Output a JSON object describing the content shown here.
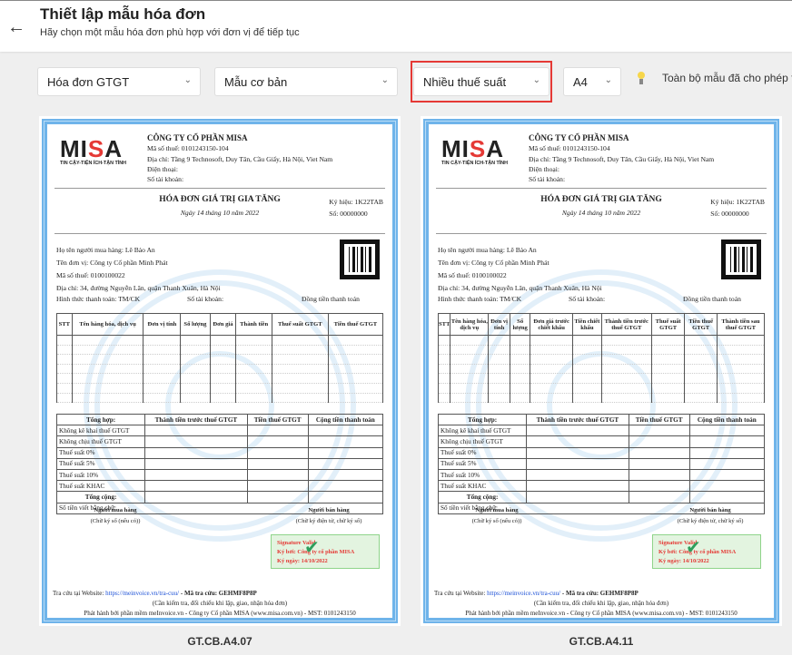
{
  "header": {
    "title": "Thiết lập mẫu hóa đơn",
    "subtitle": "Hãy chọn một mẫu hóa đơn phù hợp với đơn vị để tiếp tục"
  },
  "filters": {
    "invoice_type": "Hóa đơn GTGT",
    "template_style": "Mẫu cơ bản",
    "tax_mode": "Nhiều thuế suất",
    "paper_size": "A4",
    "note": "Toàn bộ mẫu đã cho phép t"
  },
  "colors": {
    "highlight": "#e53935",
    "border": "#6fb4ea"
  },
  "invoice": {
    "logo": "MISA",
    "logo_tagline": "TIN CẬY-TIỆN ÍCH-TẬN TÌNH",
    "seller_name": "CÔNG TY CỔ PHẦN MISA",
    "seller_tax": "Mã số thuế: 0101243150-104",
    "seller_address": "Địa chỉ: Tầng 9 Technosoft, Duy Tân, Cầu Giấy, Hà Nội, Viet Nam",
    "seller_phone": "Điện thoại:",
    "seller_account": "Số tài khoản:",
    "title": "HÓA ĐƠN GIÁ TRỊ GIA TĂNG",
    "date": "Ngày 14 tháng 10 năm 2022",
    "symbol": "Ký hiệu: 1K22TAB",
    "number": "Số: 00000000",
    "buyer_name": "Họ tên người mua hàng: Lê Bảo An",
    "buyer_company": "Tên đơn vị: Công ty Cổ phần Minh Phát",
    "buyer_tax": "Mã số thuế: 0100100022",
    "buyer_address": "Địa chỉ: 34, đường Nguyễn Lân, quận Thanh Xuân, Hà Nội",
    "payment": "Hình thức thanh toán: TM/CK",
    "account": "Số tài khoản:",
    "currency": "Đồng tiền thanh toán",
    "summary_headers": [
      "Tổng hợp:",
      "Thành tiền trước thuế GTGT",
      "Tiền thuế GTGT",
      "Cộng tiền thanh toán"
    ],
    "summary_rows": [
      "Không kê khai thuế GTGT",
      "Không chịu thuế GTGT",
      "Thuế suất 0%",
      "Thuế suất 5%",
      "Thuế suất 10%",
      "Thuế suất KHAC"
    ],
    "total": "Tổng cộng:",
    "in_words": "Số tiền viết bằng chữ:",
    "buyer_sign": "Người mua hàng",
    "buyer_sign_note": "(Chữ ký số (nếu có))",
    "seller_sign": "Người bán hàng",
    "seller_sign_note": "(Chữ ký điện tử, chữ ký số)",
    "sig_valid": "Signature Valid",
    "sig_by": "Ký bởi: Công ty cổ phần MISA",
    "sig_date": "Ký ngày: 14/10/2022",
    "lookup_prefix": "Tra cứu tại Website:",
    "lookup_url": "https://meinvoice.vn/tra-cuu/",
    "lookup_code": "- Mã tra cứu: GEHMF8P8P",
    "check_note": "(Cần kiểm tra, đối chiếu khi lập, giao, nhận hóa đơn)",
    "issuer": "Phát hành bởi phần mềm meInvoice.vn - Công ty Cổ phần MISA (www.misa.com.vn) - MST: 0101243150"
  },
  "templates": [
    {
      "code": "GT.CB.A4.07",
      "columns": [
        "STT",
        "Tên hàng hóa, dịch vụ",
        "Đơn vị tính",
        "Số lượng",
        "Đơn giá",
        "Thành tiền",
        "Thuế suất GTGT",
        "Tiền thuế GTGT"
      ]
    },
    {
      "code": "GT.CB.A4.11",
      "columns": [
        "STT",
        "Tên hàng hóa, dịch vụ",
        "Đơn vị tính",
        "Số lượng",
        "Đơn giá trước chiết khấu",
        "Tiền chiết khấu",
        "Thành tiền trước thuế GTGT",
        "Thuế suất GTGT",
        "Tiền thuế GTGT",
        "Thành tiền sau thuế GTGT"
      ]
    }
  ]
}
